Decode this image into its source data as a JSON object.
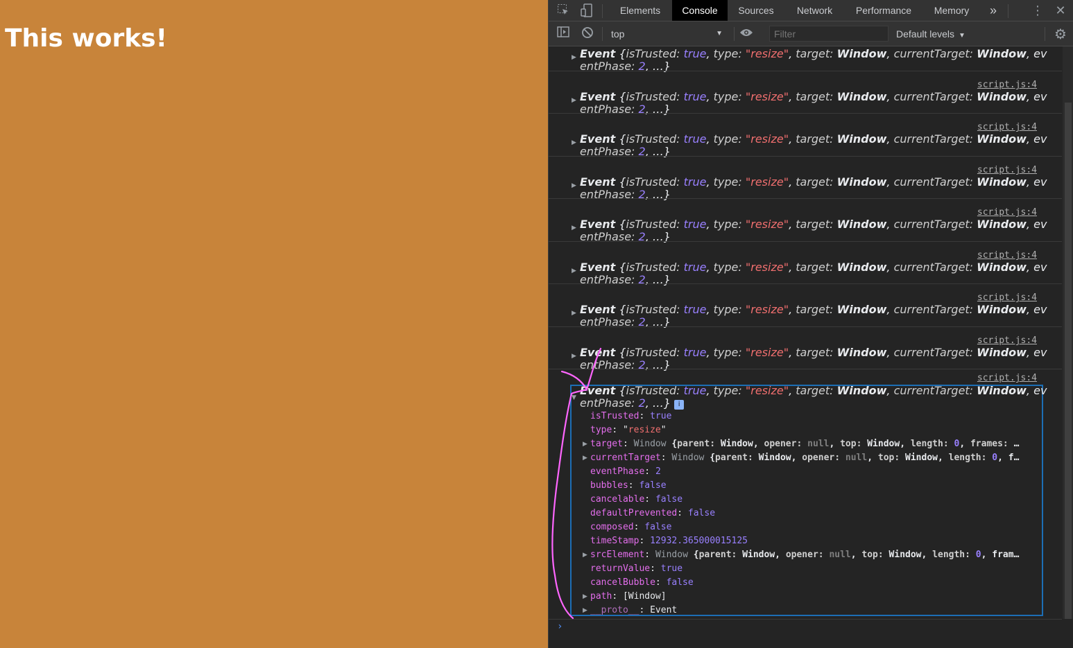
{
  "page": {
    "heading": "This works!"
  },
  "devtools": {
    "tabs": [
      "Elements",
      "Console",
      "Sources",
      "Network",
      "Performance",
      "Memory"
    ],
    "active_tab": "Console",
    "more_tabs": "»",
    "toolbar": {
      "context": "top",
      "filter_placeholder": "Filter",
      "levels": "Default levels"
    },
    "messages": {
      "source": "script.js:4",
      "collapsed_line1": "Event {isTrusted: true, type: \"resize\", target: Window, currentTarget: Window, ev",
      "collapsed_line2": "entPhase: 2, …}",
      "count": 9
    },
    "expanded": {
      "badge": "i",
      "props": [
        {
          "key": "isTrusted",
          "value": "true",
          "kind": "bool",
          "expandable": false
        },
        {
          "key": "type",
          "value": "\"resize\"",
          "kind": "str",
          "expandable": false
        },
        {
          "key": "target",
          "value": "Window {parent: Window, opener: null, top: Window, length: 0, frames: …",
          "kind": "obj",
          "expandable": true
        },
        {
          "key": "currentTarget",
          "value": "Window {parent: Window, opener: null, top: Window, length: 0, f…",
          "kind": "obj",
          "expandable": true
        },
        {
          "key": "eventPhase",
          "value": "2",
          "kind": "bool",
          "expandable": false
        },
        {
          "key": "bubbles",
          "value": "false",
          "kind": "bool",
          "expandable": false
        },
        {
          "key": "cancelable",
          "value": "false",
          "kind": "bool",
          "expandable": false
        },
        {
          "key": "defaultPrevented",
          "value": "false",
          "kind": "bool",
          "expandable": false
        },
        {
          "key": "composed",
          "value": "false",
          "kind": "bool",
          "expandable": false
        },
        {
          "key": "timeStamp",
          "value": "12932.365000015125",
          "kind": "bool",
          "expandable": false
        },
        {
          "key": "srcElement",
          "value": "Window {parent: Window, opener: null, top: Window, length: 0, fram…",
          "kind": "obj",
          "expandable": true
        },
        {
          "key": "returnValue",
          "value": "true",
          "kind": "bool",
          "expandable": false
        },
        {
          "key": "cancelBubble",
          "value": "false",
          "kind": "bool",
          "expandable": false
        },
        {
          "key": "path",
          "value": "[Window]",
          "kind": "plain",
          "expandable": true
        },
        {
          "key": "__proto__",
          "value": "Event",
          "kind": "plain",
          "expandable": true
        }
      ]
    },
    "prompt": "›"
  },
  "colors": {
    "page_bg": "#c8843a",
    "devtools_bg": "#242424",
    "annotation": "#ff66ff",
    "selection_border": "#1c6eb5"
  },
  "icons": [
    "inspect-icon",
    "device-toggle-icon",
    "more-tabs-icon",
    "kebab-menu-icon",
    "close-icon",
    "sidebar-toggle-icon",
    "clear-console-icon",
    "dropdown-arrow-icon",
    "eye-icon",
    "settings-gear-icon"
  ]
}
